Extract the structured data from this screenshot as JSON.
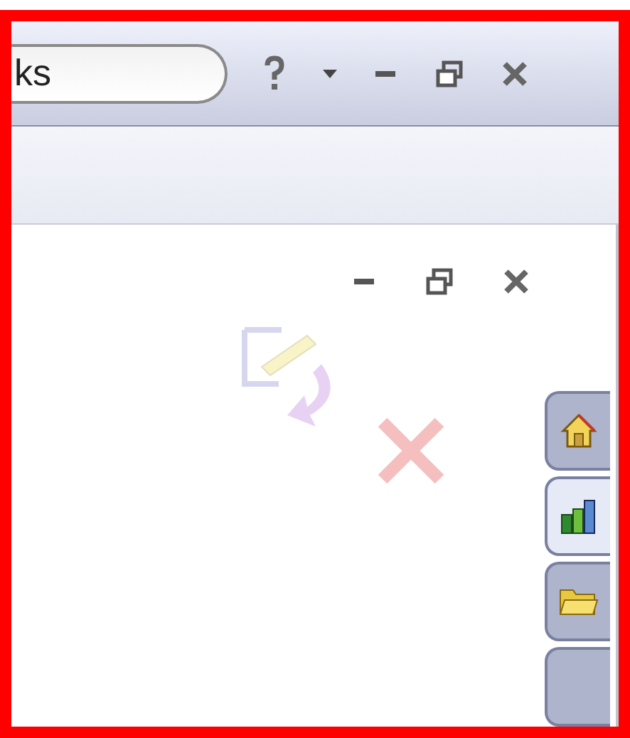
{
  "search": {
    "value": "ks"
  },
  "task_pane_tabs": [
    {
      "kind": "home",
      "selected": false
    },
    {
      "kind": "chart",
      "selected": true
    },
    {
      "kind": "folder",
      "selected": false
    },
    {
      "kind": "blank",
      "selected": false
    }
  ]
}
